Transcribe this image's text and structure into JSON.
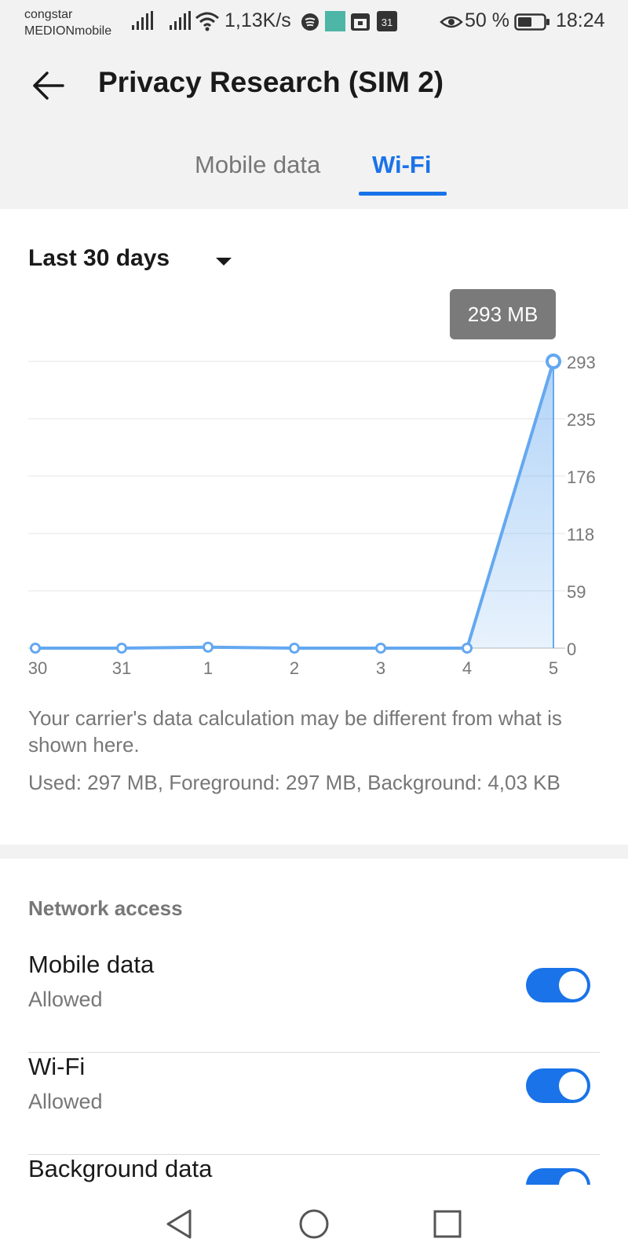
{
  "status_bar": {
    "carrier_line1": "congstar",
    "carrier_line2": "MEDIONmobile",
    "speed": "1,13K/s",
    "battery": "50 %",
    "time": "18:24",
    "calendar_day": "31",
    "icons": [
      "signal-icon",
      "signal-icon",
      "wifi-icon",
      "spotify-icon",
      "app-icon",
      "calendar-icon",
      "calendar-icon",
      "eye-comfort-icon",
      "battery-icon"
    ]
  },
  "header": {
    "title": "Privacy Research (SIM 2)",
    "tabs": [
      {
        "label": "Mobile data",
        "active": false
      },
      {
        "label": "Wi-Fi",
        "active": true
      }
    ]
  },
  "period": {
    "label": "Last 30 days"
  },
  "chart_data": {
    "type": "area",
    "categories": [
      "30",
      "31",
      "1",
      "2",
      "3",
      "4",
      "5"
    ],
    "values": [
      0,
      0,
      1,
      0,
      0,
      0,
      293
    ],
    "y_ticks": [
      "293",
      "235",
      "176",
      "118",
      "59",
      "0"
    ],
    "ylim": [
      0,
      293
    ],
    "tooltip": "293 MB",
    "color": "#64a8f0",
    "grid": true
  },
  "notes": {
    "carrier_note": "Your carrier's data calculation may be different from what is shown here.",
    "usage": "Used: 297 MB, Foreground: 297 MB, Background: 4,03 KB"
  },
  "network_access": {
    "title": "Network access",
    "items": [
      {
        "label": "Mobile data",
        "status": "Allowed",
        "enabled": true
      },
      {
        "label": "Wi-Fi",
        "status": "Allowed",
        "enabled": true
      },
      {
        "label": "Background data",
        "status": "",
        "enabled": true
      }
    ]
  },
  "colors": {
    "accent": "#1a73e8",
    "background_gray": "#f2f2f2"
  }
}
